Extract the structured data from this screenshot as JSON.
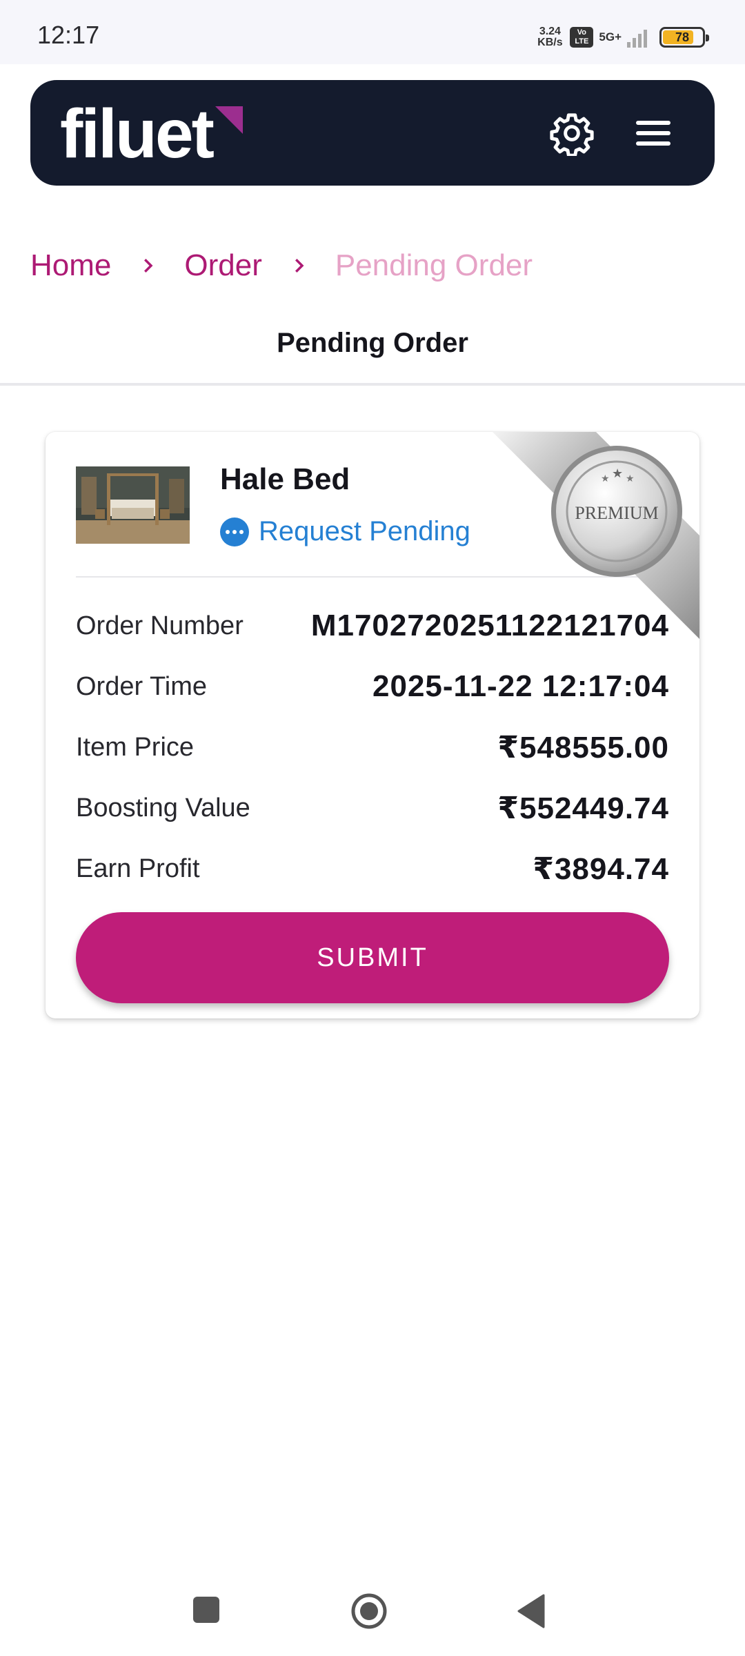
{
  "status_bar": {
    "time": "12:17",
    "net_speed_value": "3.24",
    "net_speed_unit": "KB/s",
    "volte_top": "Vo",
    "volte_bottom": "LTE",
    "network": "5G+",
    "battery": "78"
  },
  "header": {
    "logo": "filuet",
    "accent_color": "#9c2e8f",
    "background": "#141b2d",
    "icons": [
      "gear-icon",
      "menu-icon"
    ]
  },
  "breadcrumb": {
    "home": "Home",
    "order": "Order",
    "current": "Pending Order"
  },
  "page_title": "Pending Order",
  "order_card": {
    "product_name": "Hale Bed",
    "status": "Request Pending",
    "badge": "PREMIUM",
    "rows": [
      {
        "label": "Order Number",
        "value": "M1702720251122121704"
      },
      {
        "label": "Order Time",
        "value": "2025-11-22 12:17:04"
      },
      {
        "label": "Item Price",
        "value": "₹548555.00"
      },
      {
        "label": "Boosting Value",
        "value": "₹552449.74"
      },
      {
        "label": "Earn Profit",
        "value": "₹3894.74"
      }
    ],
    "submit_label": "SUBMIT",
    "submit_color": "#bf1d79"
  },
  "nav_bar": {
    "icons": [
      "recent-apps-icon",
      "home-icon",
      "back-icon"
    ]
  }
}
